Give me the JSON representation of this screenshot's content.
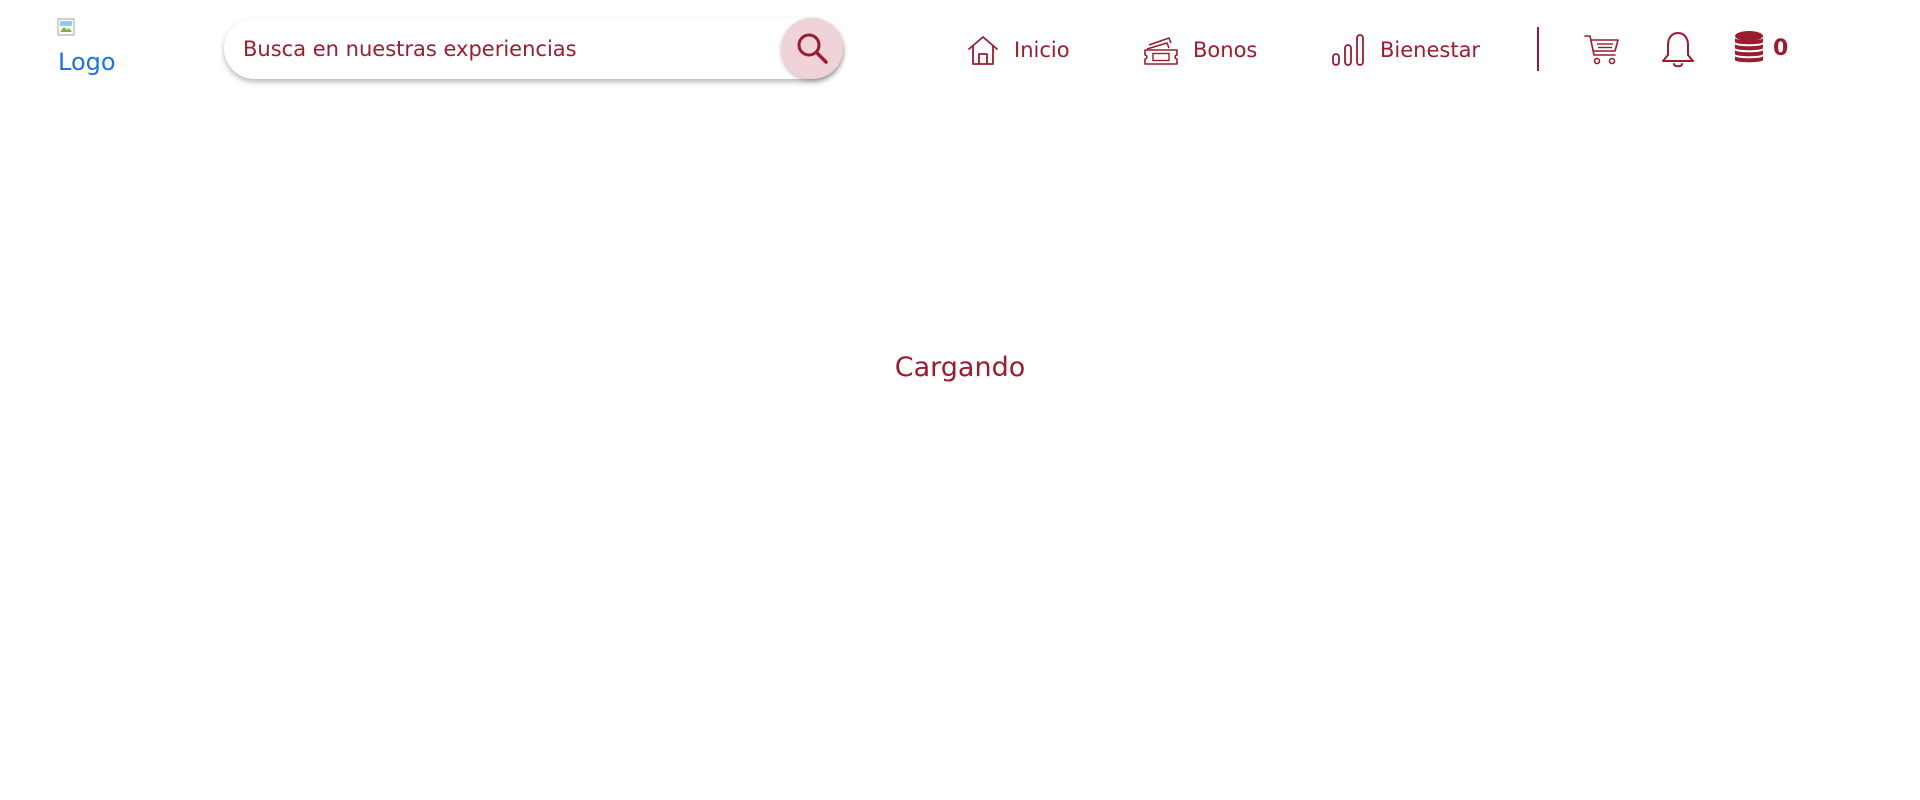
{
  "header": {
    "logo_alt": "Logo",
    "search": {
      "placeholder": "Busca en nuestras experiencias",
      "button_icon": "search-icon"
    },
    "nav": [
      {
        "label": "Inicio",
        "icon": "home-icon"
      },
      {
        "label": "Bonos",
        "icon": "tickets-icon"
      },
      {
        "label": "Bienestar",
        "icon": "bar-chart-icon"
      }
    ],
    "actions": {
      "cart_icon": "cart-icon",
      "notifications_icon": "bell-icon",
      "coins_icon": "coins-icon",
      "coins_count": "0"
    }
  },
  "main": {
    "loading_text": "Cargando"
  },
  "colors": {
    "accent": "#9b1c2e",
    "search_button_bg": "#efd3d8",
    "logo_alt_text": "#1a73e8"
  }
}
